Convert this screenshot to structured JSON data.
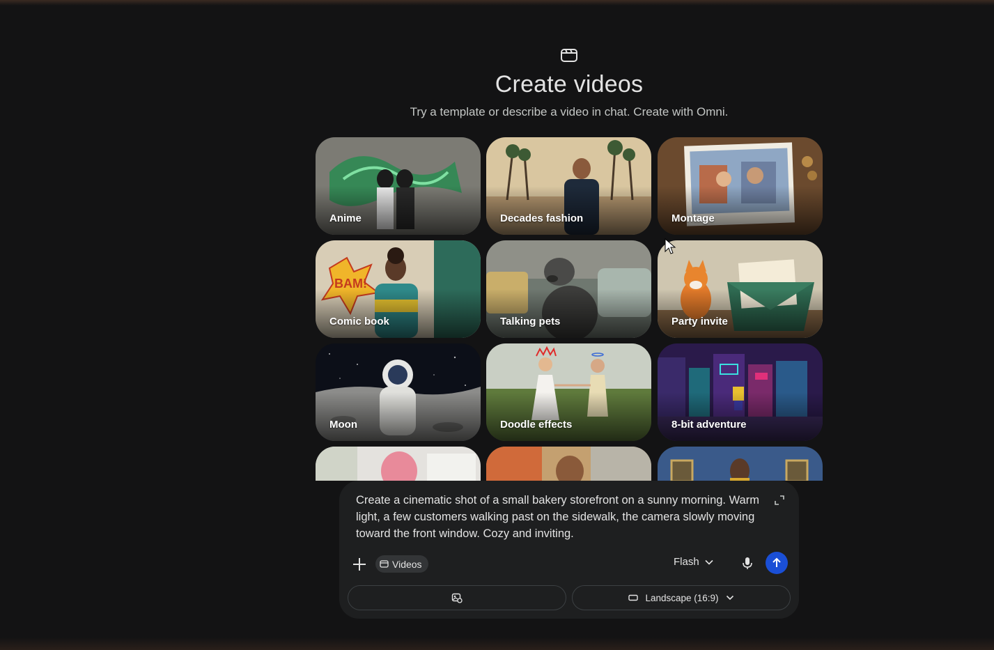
{
  "header": {
    "icon": "video-clapper-icon",
    "title": "Create videos",
    "subtitle": "Try a template or describe a video in chat. Create with Omni."
  },
  "templates": [
    {
      "label": "Anime"
    },
    {
      "label": "Decades fashion"
    },
    {
      "label": "Montage"
    },
    {
      "label": "Comic book"
    },
    {
      "label": "Talking pets"
    },
    {
      "label": "Party invite"
    },
    {
      "label": "Moon"
    },
    {
      "label": "Doodle effects"
    },
    {
      "label": "8-bit adventure"
    }
  ],
  "composer": {
    "prompt_text": "Create a cinematic shot of a small bakery storefront on a sunny morning. Warm light, a few customers walking past on the sidewalk, the camera slowly moving toward the front window. Cozy and inviting.",
    "chip_label": "Videos",
    "model_label": "Flash",
    "aspect_label": "Landscape (16:9)",
    "accent_color": "#1a4fd6"
  }
}
